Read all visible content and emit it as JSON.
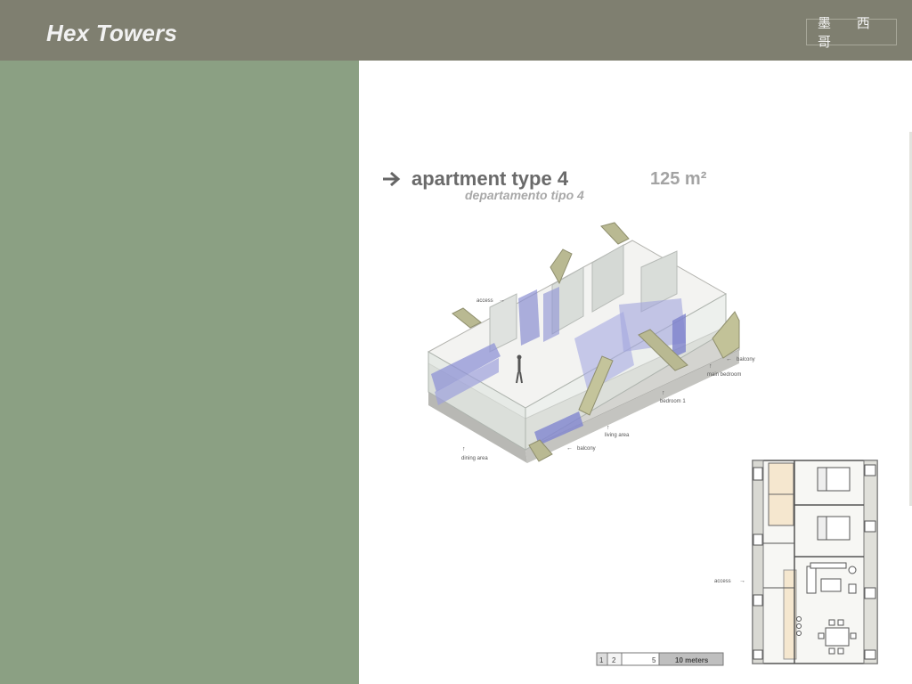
{
  "header": {
    "title": "Hex Towers",
    "badge": "墨 西 哥"
  },
  "slide": {
    "heading": "apartment type 4",
    "area": "125 m²",
    "subheading": "departamento tipo 4",
    "iso_labels": {
      "access": "access",
      "balcony_right": "balcony",
      "main_bedroom": "main bedroom",
      "bedroom1": "bedroom 1",
      "living_area": "living area",
      "balcony_bottom": "balcony",
      "dining_area": "dining area"
    },
    "plan_access": "access",
    "scale": {
      "s1": "1",
      "s2": "2",
      "s5": "5",
      "s10": "10 meters"
    }
  }
}
